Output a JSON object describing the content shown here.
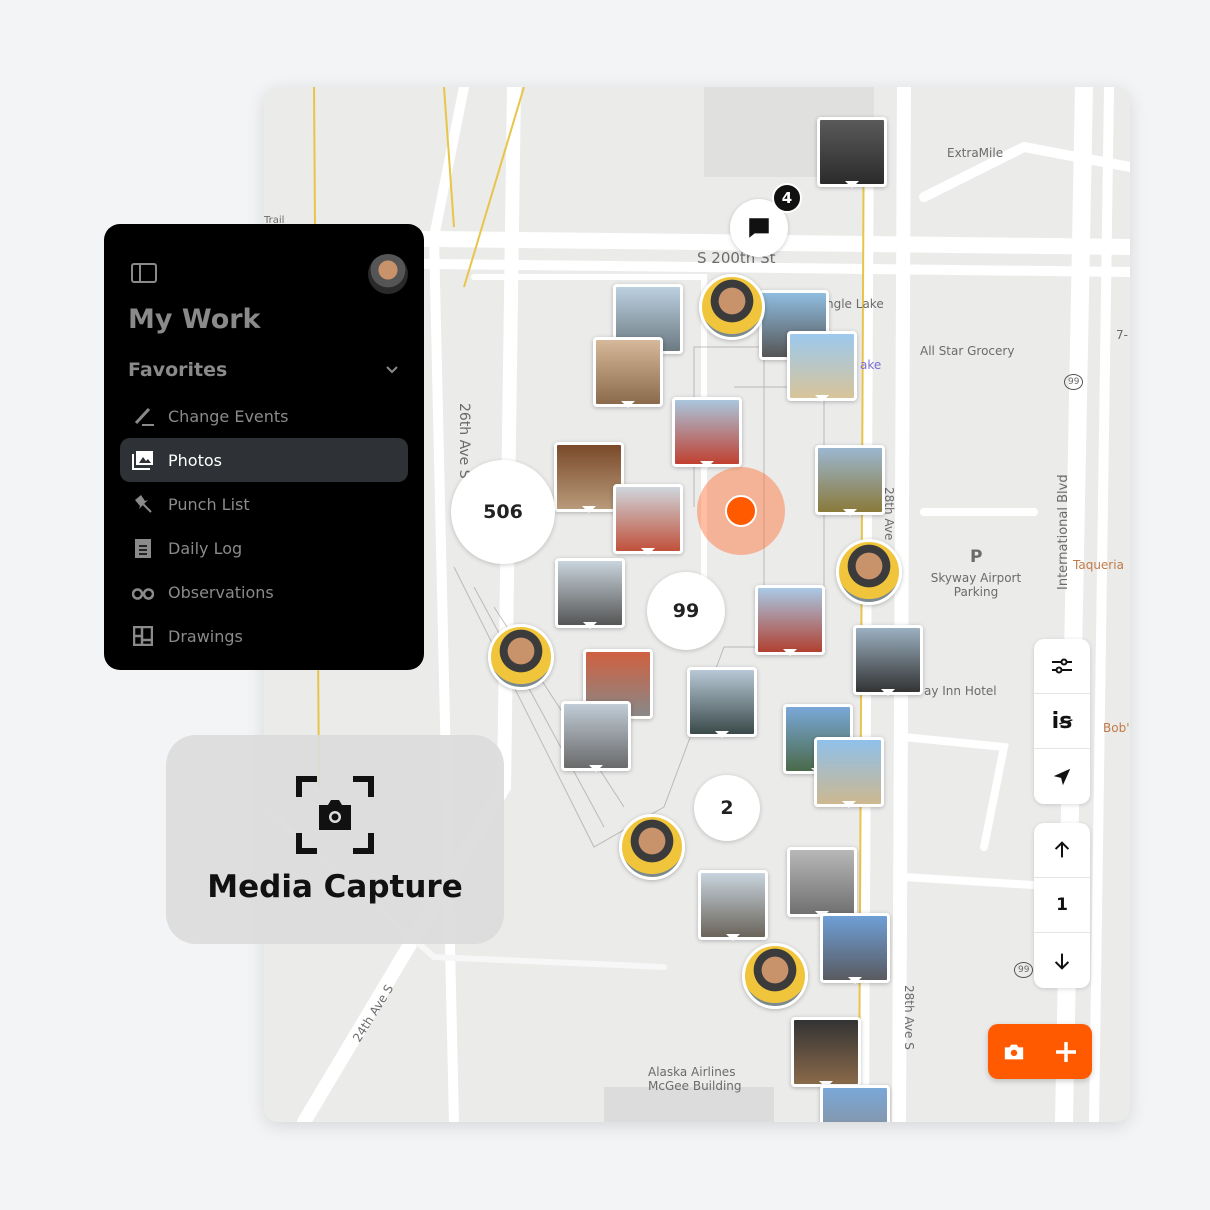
{
  "sidebar": {
    "title": "My Work",
    "section": "Favorites",
    "items": [
      {
        "label": "Change Events",
        "icon": "pen-ruler-icon"
      },
      {
        "label": "Photos",
        "icon": "photos-icon",
        "active": true
      },
      {
        "label": "Punch List",
        "icon": "pushpin-icon"
      },
      {
        "label": "Daily Log",
        "icon": "clipboard-icon"
      },
      {
        "label": "Observations",
        "icon": "binoculars-icon"
      },
      {
        "label": "Drawings",
        "icon": "drawings-icon"
      }
    ]
  },
  "media_capture": {
    "label": "Media Capture",
    "icon": "camera-frame-icon"
  },
  "map": {
    "labels": {
      "street_200th": "S 200th St",
      "ave26": "26th Ave S",
      "ave28_top": "28th Ave",
      "ave28_bottom": "28th Ave S",
      "ave24": "24th Ave S",
      "intl_blvd": "International Blvd",
      "extramile": "ExtraMile",
      "allstar": "All Star Grocery",
      "angle_lake": "ngle Lake",
      "lake": "ake",
      "parking_p": "P",
      "parking": "Skyway Airport Parking",
      "taqueria": "Taqueria",
      "bobs": "Bob'",
      "hotel": "ay Inn Hotel",
      "alaska": "Alaska Airlines McGee Building",
      "trail": "Trail",
      "route99": "99",
      "seven": "7-"
    },
    "clusters": [
      "506",
      "99",
      "2"
    ],
    "comment_badge": "4",
    "level": "1",
    "accent": "#ff5a00"
  },
  "controls": {
    "filter_icon": "sliders-icon",
    "layers_icon": "is-logo-icon",
    "locate_icon": "navigation-arrow-icon",
    "up_icon": "arrow-up-icon",
    "down_icon": "arrow-down-icon"
  }
}
